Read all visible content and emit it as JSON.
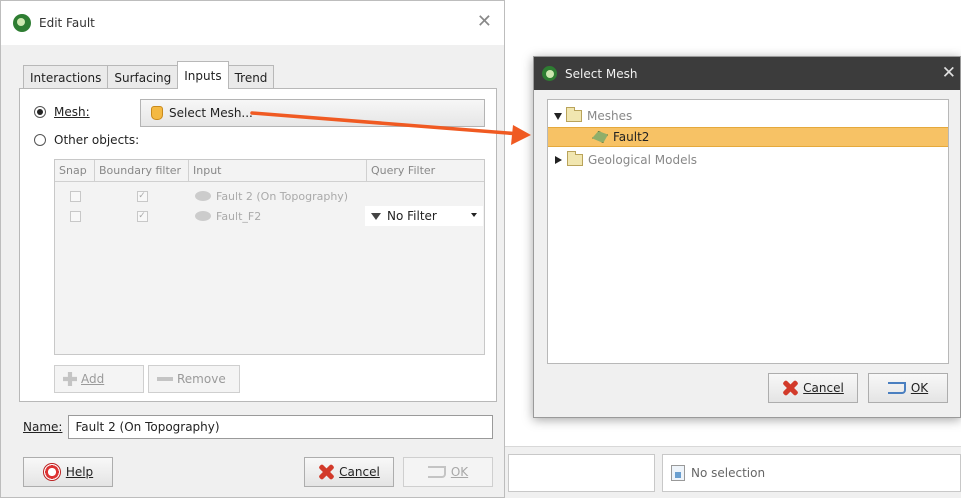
{
  "edit_dialog": {
    "title": "Edit Fault",
    "tabs": [
      "Interactions",
      "Surfacing",
      "Inputs",
      "Trend"
    ],
    "active_tab": "Inputs",
    "mesh_radio_label": "Mesh:",
    "other_radio_label": "Other objects:",
    "select_mesh_label": "Select Mesh...",
    "grid": {
      "columns": [
        "Snap",
        "Boundary filter",
        "Input",
        "Query Filter"
      ],
      "rows": [
        {
          "input": "Fault 2 (On Topography)",
          "filter": ""
        },
        {
          "input": "Fault_F2",
          "filter": "No Filter"
        }
      ]
    },
    "add_label": "Add",
    "remove_label": "Remove",
    "name_label": "Name:",
    "name_value": "Fault 2 (On Topography)",
    "help_label": "Help",
    "cancel_label": "Cancel",
    "ok_label": "OK"
  },
  "mesh_dialog": {
    "title": "Select Mesh",
    "tree": {
      "meshes_label": "Meshes",
      "selected_item": "Fault2",
      "geo_models_label": "Geological Models"
    },
    "cancel_label": "Cancel",
    "ok_label": "OK"
  },
  "status_bar": {
    "selection_text": "No selection"
  },
  "colors": {
    "arrow": "#f05a22",
    "selection": "#f7c265",
    "title_dark": "#3c3c3c"
  }
}
